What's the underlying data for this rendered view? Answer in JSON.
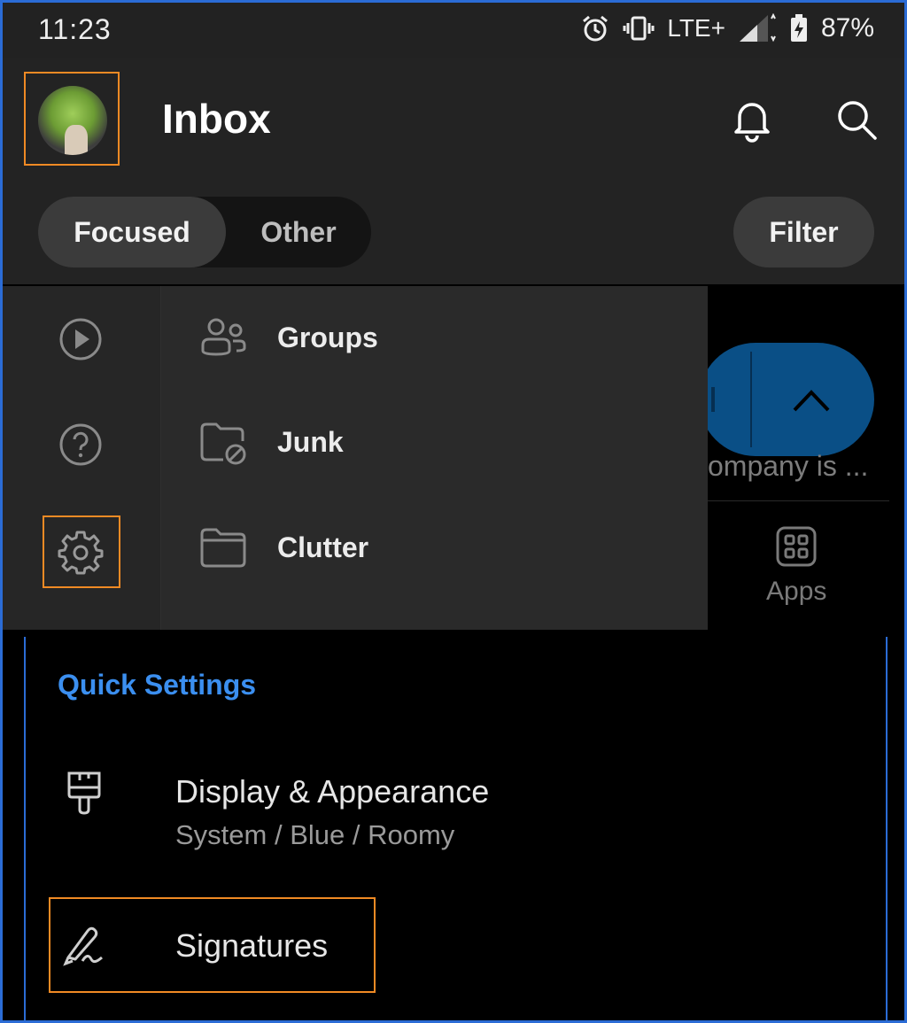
{
  "status_bar": {
    "time": "11:23",
    "network": "LTE+",
    "battery": "87%",
    "icons": [
      "alarm-icon",
      "vibrate-icon",
      "signal-icon",
      "battery-charging-icon"
    ]
  },
  "header": {
    "title": "Inbox",
    "tabs": [
      {
        "label": "Focused",
        "selected": true
      },
      {
        "label": "Other",
        "selected": false
      }
    ],
    "filter_label": "Filter"
  },
  "background": {
    "snippet": "ompany is ...",
    "apps_label": "Apps"
  },
  "drawer": {
    "rail_icons": [
      "play-icon",
      "help-icon",
      "gear-icon"
    ],
    "items": [
      {
        "label": "Groups",
        "icon": "groups-icon"
      },
      {
        "label": "Junk",
        "icon": "junk-folder-icon"
      },
      {
        "label": "Clutter",
        "icon": "folder-icon"
      }
    ]
  },
  "quick_settings": {
    "title": "Quick Settings",
    "display": {
      "label": "Display & Appearance",
      "subtitle": "System / Blue / Roomy",
      "icon": "paintbrush-icon"
    },
    "signatures": {
      "label": "Signatures",
      "icon": "signature-pen-icon"
    }
  },
  "colors": {
    "accent_blue": "#3b8ff0",
    "highlight_orange": "#f08a24",
    "header_bg": "#232323",
    "drawer_bg": "#2a2a2a"
  }
}
